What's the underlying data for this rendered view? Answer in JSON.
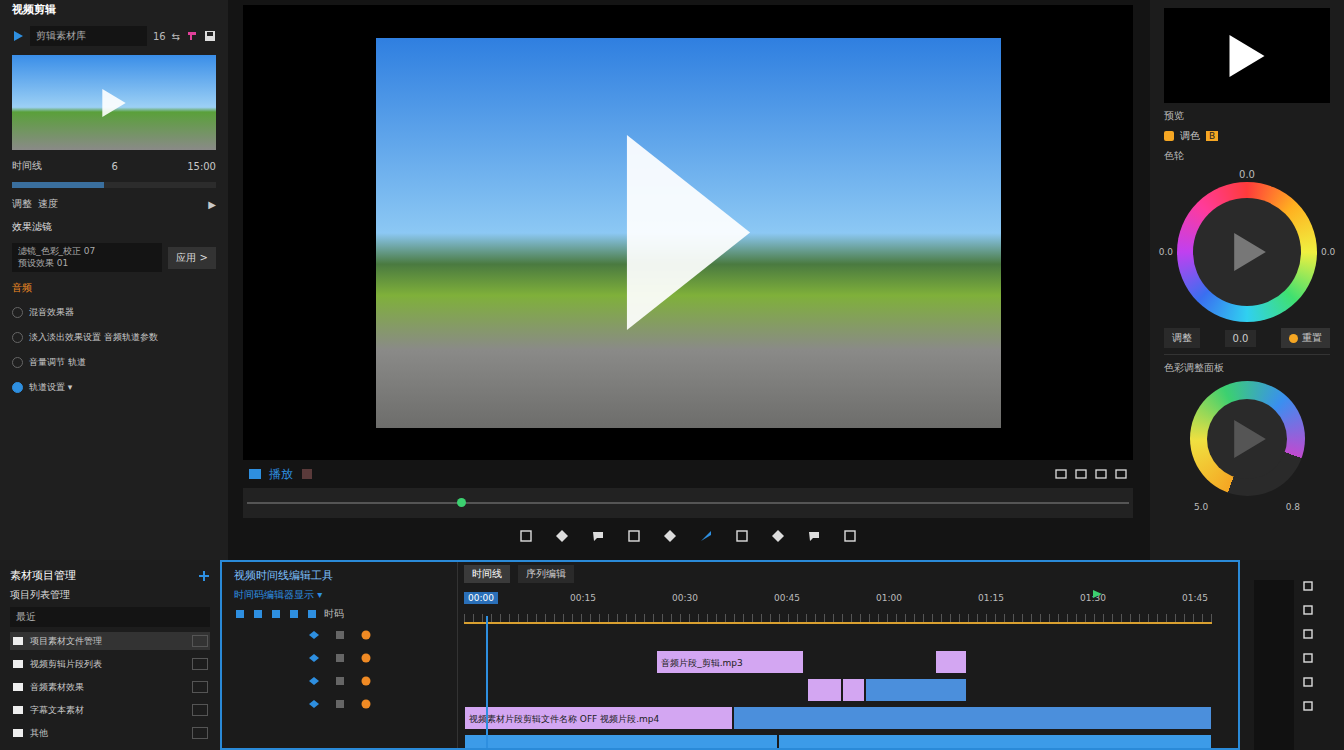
{
  "app": {
    "title": "视频剪辑"
  },
  "media_panel": {
    "search": "剪辑素材库",
    "count": "16",
    "swap": "⇆",
    "timeline_row": {
      "label": "时间线",
      "value": "6",
      "end": "15:00"
    },
    "slider": {
      "level": 0.45
    },
    "speed_row": {
      "label": "调整",
      "sub": "速度",
      "icon": "▶"
    },
    "effects_title": "效果滤镜",
    "effect_field": [
      "滤镜_色彩_校正 07",
      "预设效果 01"
    ],
    "apply_button": "应用 >",
    "audio_title": "音频",
    "audio_items": [
      {
        "label": "混音效果器",
        "checked": false
      },
      {
        "label": "淡入淡出效果设置 音频轨道参数",
        "checked": false
      },
      {
        "label": "音量调节 轨道",
        "checked": false
      },
      {
        "label": "轨道设置 ▾",
        "checked": true
      }
    ]
  },
  "preview": {
    "play_label": "播放",
    "scrubber": {
      "level": 0.24
    }
  },
  "right_panel": {
    "monitor_label": "预览",
    "grade_title": "调色",
    "grade_badge": "B",
    "wheel_title": "色轮",
    "wheel_labels": {
      "top": "0.0",
      "left": "0.0",
      "right": "0.0"
    },
    "buttons": [
      {
        "label": "调整",
        "kind": "plain"
      },
      {
        "label": "0.0",
        "kind": "plain"
      },
      {
        "label": "重置",
        "kind": "accent"
      }
    ],
    "adjust_title": "色彩调整面板",
    "donut": {
      "level": 0.75,
      "left": "5.0",
      "right": "0.8"
    }
  },
  "project_panel": {
    "title": "素材项目管理",
    "subtitle": "项目列表管理",
    "filter": "最近",
    "items": [
      {
        "label": "项目素材文件管理",
        "selected": true
      },
      {
        "label": "视频剪辑片段列表",
        "selected": false
      },
      {
        "label": "音频素材效果",
        "selected": false
      },
      {
        "label": "字幕文本素材",
        "selected": false
      },
      {
        "label": "其他",
        "selected": false
      }
    ]
  },
  "timeline": {
    "title": "视频时间线编辑工具",
    "timecode": "时间码编辑器显示 ▾",
    "tool_label": "时码",
    "tabs": [
      {
        "label": "时间线",
        "selected": true
      },
      {
        "label": "序列编辑",
        "selected": false
      }
    ],
    "ruler": [
      "00:00",
      "00:15",
      "00:30",
      "00:45",
      "01:00",
      "01:15",
      "01:30",
      "01:45"
    ],
    "playhead": {
      "level": 0.03
    },
    "marker": {
      "level": 0.84
    },
    "tracks": [
      {
        "clips": [
          {
            "label": "音频片段_剪辑.mp3",
            "start": 0.257,
            "end": 0.454,
            "color": "#d3a6f2"
          },
          {
            "label": "",
            "start": 0.63,
            "end": 0.672,
            "color": "#d3a6f2"
          }
        ]
      },
      {
        "clips": [
          {
            "label": "",
            "start": 0.458,
            "end": 0.505,
            "color": "#d3a6f2"
          },
          {
            "label": "",
            "start": 0.505,
            "end": 0.536,
            "color": "#d3a6f2"
          },
          {
            "label": "",
            "start": 0.536,
            "end": 0.672,
            "color": "#4b8fdc"
          }
        ]
      },
      {
        "clips": [
          {
            "label": "视频素材片段剪辑文件名称 OFF 视频片段.mp4",
            "start": 0.0,
            "end": 0.36,
            "color": "#d3a6f2"
          },
          {
            "label": "",
            "start": 0.36,
            "end": 1.0,
            "color": "#4b8fdc"
          }
        ]
      },
      {
        "clips": [
          {
            "label": "",
            "start": 0.0,
            "end": 0.42,
            "color": "#3c9be8"
          },
          {
            "label": "",
            "start": 0.42,
            "end": 1.0,
            "color": "#3c9be8"
          }
        ]
      }
    ]
  }
}
